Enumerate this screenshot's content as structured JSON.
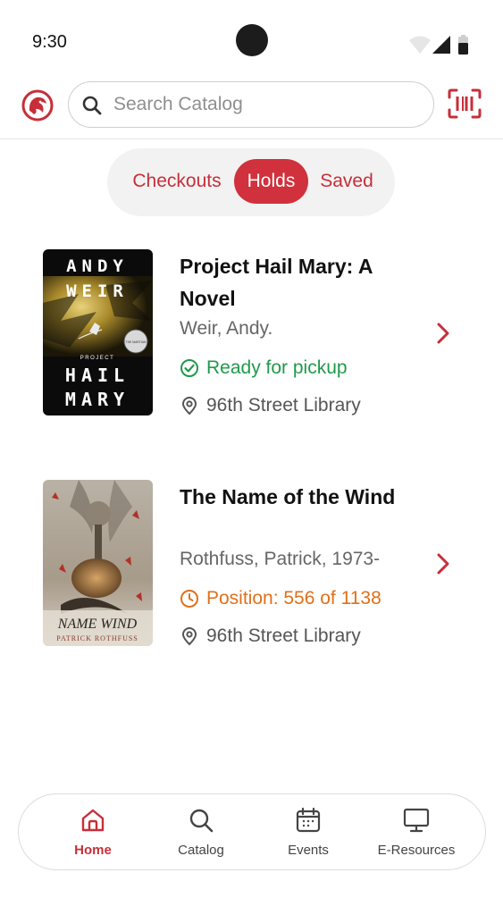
{
  "status_bar": {
    "time": "9:30"
  },
  "header": {
    "logo_icon": "library-lion-logo-icon",
    "search": {
      "placeholder": "Search Catalog",
      "value": ""
    },
    "scan_icon": "barcode-scan-icon"
  },
  "tabs": [
    {
      "label": "Checkouts",
      "selected": false
    },
    {
      "label": "Holds",
      "selected": true
    },
    {
      "label": "Saved",
      "selected": false
    }
  ],
  "holds": [
    {
      "title": "Project Hail Mary: A Novel",
      "author": "Weir, Andy.",
      "status": "Ready for pickup",
      "status_type": "ready",
      "status_icon": "check-circle-icon",
      "location": "96th Street Library",
      "cover": {
        "author_line1": "ANDY",
        "author_line2": "WEIR",
        "subtitle": "PROJECT",
        "title_line1": "HAIL",
        "title_line2": "MARY",
        "badge": "THE MARTIAN"
      }
    },
    {
      "title": "The Name of the Wind",
      "author": "Rothfuss, Patrick, 1973-",
      "status": "Position: 556 of 1138",
      "status_type": "queued",
      "status_icon": "clock-icon",
      "location": "96th Street Library",
      "cover": {
        "title": "NAME WIND",
        "author": "PATRICK ROTHFUSS"
      }
    }
  ],
  "bottom_nav": [
    {
      "label": "Home",
      "icon": "home-icon",
      "active": true
    },
    {
      "label": "Catalog",
      "icon": "search-icon",
      "active": false
    },
    {
      "label": "Events",
      "icon": "calendar-icon",
      "active": false
    },
    {
      "label": "E-Resources",
      "icon": "monitor-icon",
      "active": false
    }
  ],
  "colors": {
    "brand_red": "#d0313c",
    "ready_green": "#1f9a4b",
    "position_orange": "#e0701b"
  }
}
